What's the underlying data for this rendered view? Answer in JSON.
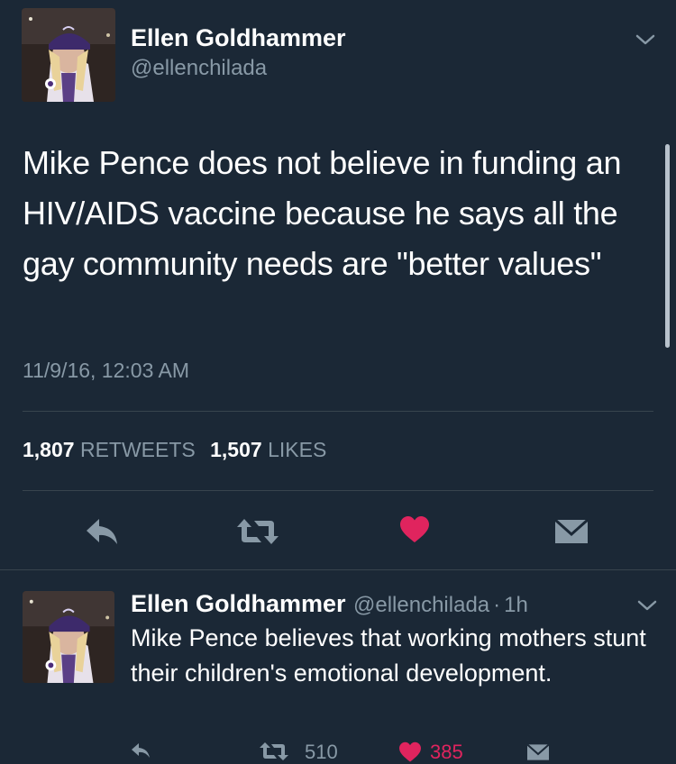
{
  "main_tweet": {
    "author_name": "Ellen Goldhammer",
    "author_handle": "@ellenchilada",
    "text": "Mike Pence does not believe in funding an HIV/AIDS vaccine because he says all the gay community needs are \"better values\"",
    "timestamp": "11/9/16, 12:03 AM",
    "retweet_count": "1,807",
    "retweet_label": "RETWEETS",
    "like_count": "1,507",
    "like_label": "LIKES",
    "liked": true
  },
  "second_tweet": {
    "author_name": "Ellen Goldhammer",
    "author_handle": "@ellenchilada",
    "separator": "·",
    "age": "1h",
    "text": "Mike Pence believes that working mothers stunt their children's emotional development.",
    "retweet_count": "510",
    "like_count": "385"
  },
  "colors": {
    "background": "#1b2836",
    "secondary_text": "#8899a6",
    "like_red": "#e0245e",
    "divider": "#38444d"
  },
  "icons": {
    "reply": "reply-arrow-icon",
    "retweet": "retweet-icon",
    "like": "heart-icon",
    "message": "envelope-icon",
    "more": "chevron-down-icon"
  }
}
